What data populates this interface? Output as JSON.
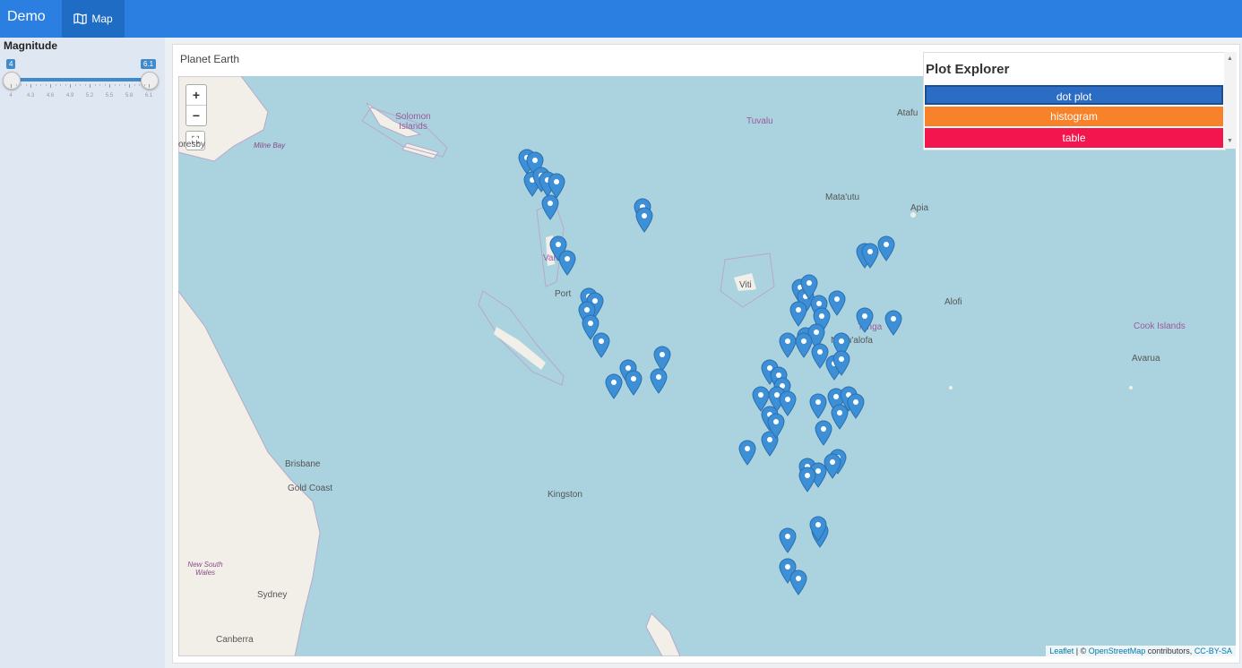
{
  "app": {
    "brand": "Demo",
    "nav_tab": "Map",
    "nav_icon": "map-icon",
    "accent": "#2a7fe0"
  },
  "sidebar": {
    "slider_label": "Magnitude",
    "range_min": "4",
    "range_max": "6.1",
    "tick_labels": [
      "4",
      "4.3",
      "4.6",
      "4.9",
      "5.2",
      "5.5",
      "5.8",
      "6.1"
    ]
  },
  "box": {
    "title": "Planet Earth"
  },
  "map": {
    "zoom_in": "+",
    "zoom_out": "−",
    "fullscreen": "⛶",
    "place_labels": [
      "Solomon Islands",
      "Tuvalu",
      "Atafu",
      "Vanuatu",
      "Port",
      "Viti",
      "Mata'utu",
      "Apia",
      "Tonga",
      "Nuku'alofa",
      "Alofi",
      "Cook Islands",
      "Avarua",
      "Brisbane",
      "Gold Coast",
      "Kingston",
      "New South Wales",
      "Sydney",
      "Canberra",
      "Milne Bay",
      "oresby"
    ],
    "attribution": {
      "leaflet": "Leaflet",
      "sep": " | © ",
      "osm": "OpenStreetMap",
      "contrib": " contributors, ",
      "license": "CC-BY-SA"
    },
    "marker_color": "#3d8fd6"
  },
  "plot_explorer": {
    "title": "Plot Explorer",
    "buttons": [
      {
        "label": "dot plot",
        "color": "#2b6cc4"
      },
      {
        "label": "histogram",
        "color": "#f88229"
      },
      {
        "label": "table",
        "color": "#f3164e"
      }
    ]
  }
}
